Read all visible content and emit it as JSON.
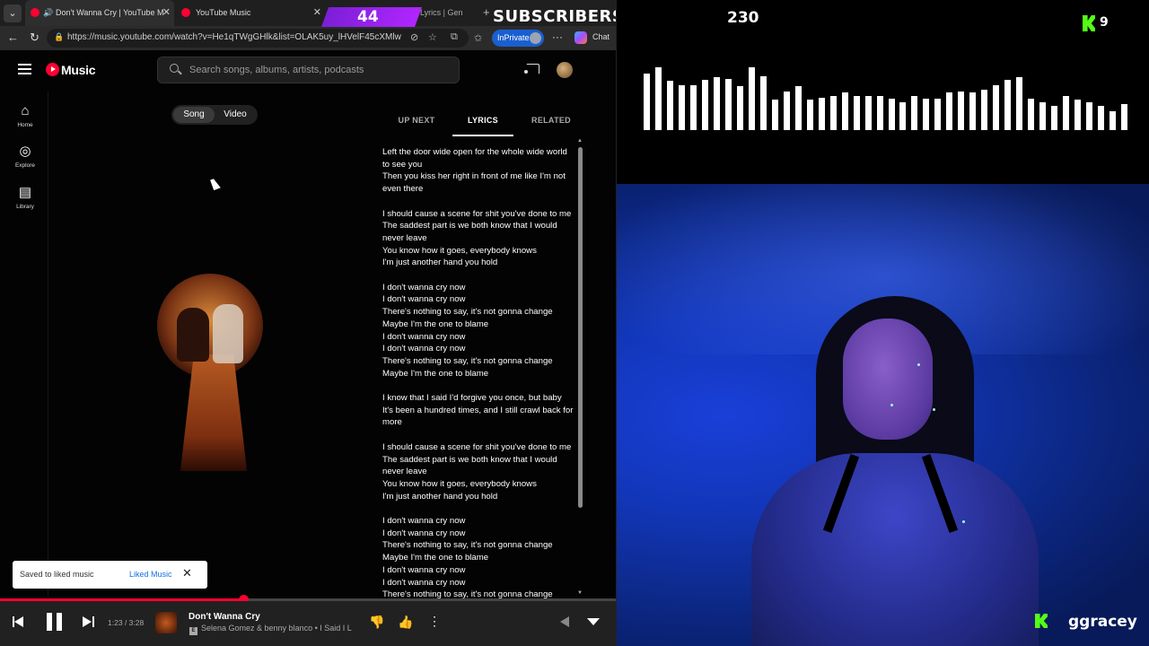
{
  "browser": {
    "tab_menu": "⌄",
    "tabs": [
      {
        "title": "Don't Wanna Cry | YouTube M",
        "close": "✕"
      },
      {
        "title": "YouTube Music",
        "close": "✕"
      },
      {
        "title": "Lyrics | Gen"
      }
    ],
    "new_tab": "+",
    "back": "←",
    "refresh": "↻",
    "url": "https://music.youtube.com/watch?v=He1qTWgGHlk&list=OLAK5uy_lHVelF45cXMlw...",
    "inprivate": "InPrivate",
    "more": "···",
    "chat": "Chat"
  },
  "overlay": {
    "subscriber_count": "44",
    "subscriber_label": "SUBSCRIBERS",
    "viewer_count": "230",
    "kick_count": "9",
    "username": "ggracey"
  },
  "ytm": {
    "logo_text": "Music",
    "search_placeholder": "Search songs, albums, artists, podcasts",
    "nav": [
      {
        "icon": "⌂",
        "label": "Home"
      },
      {
        "icon": "◎",
        "label": "Explore"
      },
      {
        "icon": "▤",
        "label": "Library"
      }
    ],
    "toggle": {
      "song": "Song",
      "video": "Video"
    },
    "panel_tabs": {
      "up_next": "UP NEXT",
      "lyrics": "LYRICS",
      "related": "RELATED"
    },
    "lyrics": [
      "Left the door wide open for the whole wide world to see you",
      "Then you kiss her right in front of me like I'm not even there",
      "",
      "I should cause a scene for shit you've done to me",
      "The saddest part is we both know that I would never leave",
      "You know how it goes, everybody knows",
      "I'm just another hand you hold",
      "",
      "I don't wanna cry now",
      "I don't wanna cry now",
      "There's nothing to say, it's not gonna change",
      "Maybe I'm the one to blame",
      "I don't wanna cry now",
      "I don't wanna cry now",
      "There's nothing to say, it's not gonna change",
      "Maybe I'm the one to blame",
      "",
      "I know that I said I'd forgive you once, but baby",
      "It's been a hundred times, and I still crawl back for more",
      "",
      "I should cause a scene for shit you've done to me",
      "The saddest part is we both know that I would never leave",
      "You know how it goes, everybody knows",
      "I'm just another hand you hold",
      "",
      "I don't wanna cry now",
      "I don't wanna cry now",
      "There's nothing to say, it's not gonna change",
      "Maybe I'm the one to blame",
      "I don't wanna cry now",
      "I don't wanna cry now",
      "There's nothing to say, it's not gonna change"
    ],
    "toast": {
      "text": "Saved to liked music",
      "link": "Liked Music",
      "close": "✕"
    },
    "player": {
      "time": "1:23 / 3:28",
      "progress": 0.395,
      "title": "Don't Wanna Cry",
      "explicit": "E",
      "subtitle": "Selena Gomez & benny blanco • I Said I L",
      "dislike": "👎",
      "like": "👍",
      "menu": "⋮"
    }
  },
  "visualizer": {
    "levels": [
      0.9,
      1.0,
      0.78,
      0.72,
      0.72,
      0.8,
      0.85,
      0.82,
      0.7,
      1.0,
      0.86,
      0.48,
      0.62,
      0.7,
      0.48,
      0.52,
      0.55,
      0.6,
      0.55,
      0.55,
      0.55,
      0.5,
      0.45,
      0.55,
      0.5,
      0.5,
      0.6,
      0.62,
      0.6,
      0.65,
      0.72,
      0.8,
      0.85,
      0.5,
      0.45,
      0.38,
      0.55,
      0.48,
      0.45,
      0.38,
      0.3,
      0.42
    ]
  },
  "colors": {
    "accent": "#ff0033",
    "kick_green": "#53fc18",
    "subscriber_purple": "#9b30ff",
    "link_blue": "#1a6ee0"
  }
}
